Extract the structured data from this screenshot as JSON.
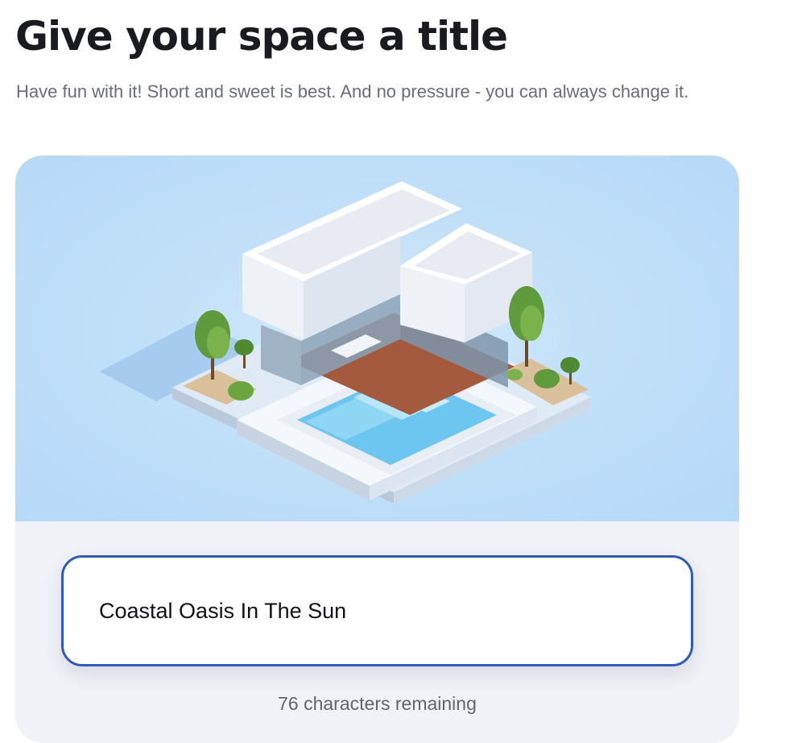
{
  "header": {
    "title": "Give your space a title",
    "subtitle": "Have fun with it! Short and sweet is best. And no pressure - you can always change it."
  },
  "title_field": {
    "value": "Coastal Oasis In The Sun",
    "remaining_text": "76 characters remaining"
  },
  "colors": {
    "hero_background": "#b6d9f7",
    "field_border": "#2f5bb7",
    "card_background": "#f1f2f7"
  }
}
